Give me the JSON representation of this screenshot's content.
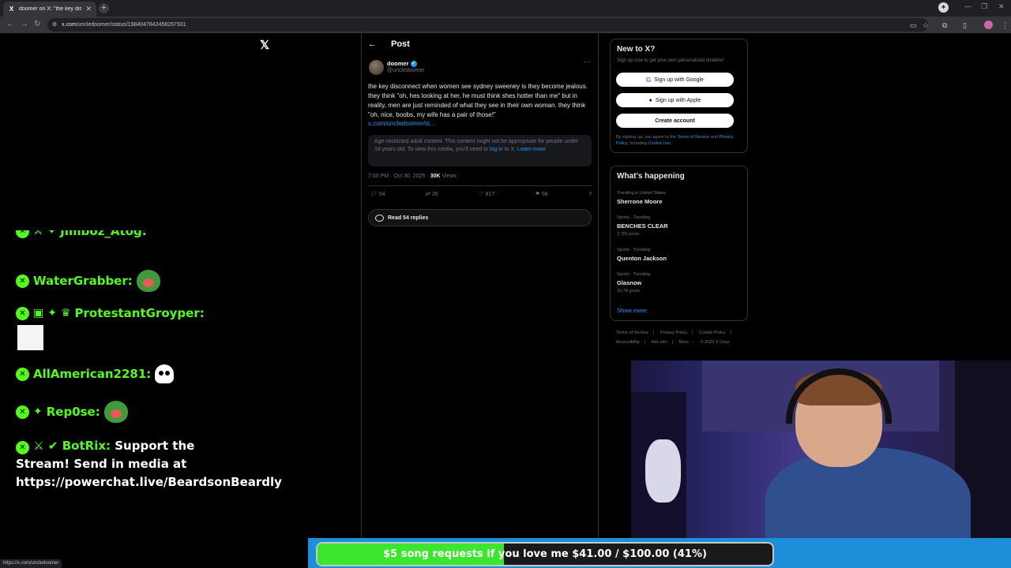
{
  "browser": {
    "tab_title": "doomer on X: \"the key disconne",
    "tab_close": "✕",
    "new_tab": "+",
    "url_host": "x.com",
    "url_path": "/uncledoomer/status/1984047842458267931",
    "status_url": "https://x.com/uncledoomer"
  },
  "x": {
    "logo": "𝕏",
    "post_header": "Post",
    "back_icon": "←",
    "author_name": "doomer",
    "author_handle": "@uncledoomer",
    "tweet_text": "the key disconnect when women see sydney sweeney is they become jealous. they think \"oh, hes looking at her, he must think shes hotter than me\" but in reality, men are just reminded of what they see in their own woman. they think \"oh, nice, boobs, my wife has a pair of those!\"",
    "tweet_link": "x.com/uncledoomer/st…",
    "age_text": "Age-restricted adult content. This content might not be appropriate for people under 18 years old. To view this media, you'll need to",
    "age_login": "log in",
    "age_mid": "to X.",
    "age_learn": "Learn more",
    "timestamp": "7:00 PM · Oct 30, 2025 · ",
    "views_count": "30K",
    "views_label": " Views",
    "replies": "54",
    "reposts": "26",
    "likes": "817",
    "bookmarks": "56",
    "read_replies": "Read 54 replies"
  },
  "sidebar": {
    "newx_title": "New to X?",
    "newx_sub": "Sign up now to get your own personalized timeline!",
    "google_btn": "Sign up with Google",
    "apple_btn": "Sign up with Apple",
    "create_btn": "Create account",
    "legal_pre": "By signing up, you agree to the",
    "legal_tos": "Terms of Service",
    "legal_and": "and",
    "legal_privacy": "Privacy Policy",
    "legal_incl": ", including",
    "legal_cookie": "Cookie Use.",
    "whats_happening": "What's happening",
    "trends": [
      {
        "category": "Trending in United States",
        "name": "Sherrone Moore",
        "count": ""
      },
      {
        "category": "Sports · Trending",
        "name": "BENCHES CLEAR",
        "count": "2,781 posts"
      },
      {
        "category": "Sports · Trending",
        "name": "Quenton Jackson",
        "count": ""
      },
      {
        "category": "Sports · Trending",
        "name": "Glasnow",
        "count": "10.7K posts"
      }
    ],
    "show_more": "Show more",
    "footer1": [
      "Terms of Service",
      "|",
      "Privacy Policy",
      "|",
      "Cookie Policy",
      "|"
    ],
    "footer2": [
      "Accessibility",
      "|",
      "Ads info",
      "|",
      "More ···",
      "© 2025 X Corp."
    ]
  },
  "chat": {
    "top_partial": "Jimboz_Atog:",
    "users": [
      "WaterGrabber:",
      "ProtestantGroyper:",
      "AllAmerican2281:",
      "Rep0se:"
    ],
    "bot_user": "BotRix:",
    "bot_message": " Support the Stream! Send in media at https://powerchat.live/BeardsonBeardly"
  },
  "goal": {
    "text": "$5 song requests if you love me $41.00 / $100.00 (41%)",
    "fraction": 0.41
  },
  "colors": {
    "x_blue": "#1d9bf0",
    "chat_green": "#53fc18",
    "goal_green": "#3ce62e"
  }
}
